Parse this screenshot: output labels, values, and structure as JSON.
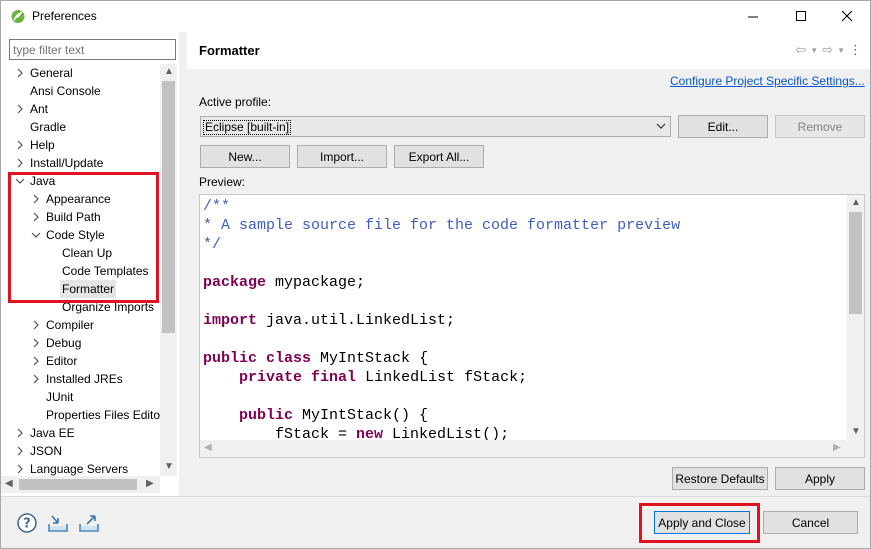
{
  "window": {
    "title": "Preferences",
    "controls": [
      "minimize-icon",
      "maximize-icon",
      "close-icon"
    ]
  },
  "filter": {
    "placeholder": "type filter text"
  },
  "tree": {
    "items": [
      {
        "label": "General",
        "expandable": true,
        "expanded": false
      },
      {
        "label": "Ansi Console",
        "expandable": false
      },
      {
        "label": "Ant",
        "expandable": true,
        "expanded": false
      },
      {
        "label": "Gradle",
        "expandable": false
      },
      {
        "label": "Help",
        "expandable": true,
        "expanded": false
      },
      {
        "label": "Install/Update",
        "expandable": true,
        "expanded": false
      },
      {
        "label": "Java",
        "expandable": true,
        "expanded": true
      },
      {
        "label": "Appearance",
        "expandable": true,
        "expanded": false
      },
      {
        "label": "Build Path",
        "expandable": true,
        "expanded": false
      },
      {
        "label": "Code Style",
        "expandable": true,
        "expanded": true
      },
      {
        "label": "Clean Up",
        "expandable": false
      },
      {
        "label": "Code Templates",
        "expandable": false
      },
      {
        "label": "Formatter",
        "expandable": false,
        "selected": true
      },
      {
        "label": "Organize Imports",
        "expandable": false
      },
      {
        "label": "Compiler",
        "expandable": true,
        "expanded": false
      },
      {
        "label": "Debug",
        "expandable": true,
        "expanded": false
      },
      {
        "label": "Editor",
        "expandable": true,
        "expanded": false
      },
      {
        "label": "Installed JREs",
        "expandable": true,
        "expanded": false
      },
      {
        "label": "JUnit",
        "expandable": false
      },
      {
        "label": "Properties Files Editor",
        "expandable": false
      },
      {
        "label": "Java EE",
        "expandable": true,
        "expanded": false
      },
      {
        "label": "JSON",
        "expandable": true,
        "expanded": false
      },
      {
        "label": "Language Servers",
        "expandable": true,
        "expanded": false
      }
    ]
  },
  "page": {
    "title": "Formatter",
    "nav_back": "⇦",
    "nav_forward": "⇨",
    "nav_menu": "⋮",
    "configure_link": "Configure Project Specific Settings...",
    "active_profile_label": "Active profile:",
    "profile_value": "Eclipse [built-in]",
    "edit_button": "Edit...",
    "remove_button": "Remove",
    "new_button": "New...",
    "import_button": "Import...",
    "export_button": "Export All...",
    "preview_label": "Preview:",
    "restore_defaults_button": "Restore Defaults",
    "apply_button": "Apply"
  },
  "preview_code": [
    {
      "parts": [
        {
          "t": "/**",
          "c": "cm"
        }
      ]
    },
    {
      "parts": [
        {
          "t": "* A sample source file for the code formatter preview",
          "c": "cm"
        }
      ]
    },
    {
      "parts": [
        {
          "t": "*/",
          "c": "cm"
        }
      ]
    },
    {
      "parts": []
    },
    {
      "parts": [
        {
          "t": "package",
          "c": "kw"
        },
        {
          "t": " mypackage;",
          "c": ""
        }
      ]
    },
    {
      "parts": []
    },
    {
      "parts": [
        {
          "t": "import",
          "c": "kw"
        },
        {
          "t": " java.util.LinkedList;",
          "c": ""
        }
      ]
    },
    {
      "parts": []
    },
    {
      "parts": [
        {
          "t": "public",
          "c": "kw"
        },
        {
          "t": " ",
          "c": ""
        },
        {
          "t": "class",
          "c": "kw"
        },
        {
          "t": " MyIntStack {",
          "c": ""
        }
      ]
    },
    {
      "parts": [
        {
          "t": "    ",
          "c": ""
        },
        {
          "t": "private",
          "c": "kw"
        },
        {
          "t": " ",
          "c": ""
        },
        {
          "t": "final",
          "c": "kw"
        },
        {
          "t": " LinkedList fStack;",
          "c": ""
        }
      ]
    },
    {
      "parts": []
    },
    {
      "parts": [
        {
          "t": "    ",
          "c": ""
        },
        {
          "t": "public",
          "c": "kw"
        },
        {
          "t": " MyIntStack() {",
          "c": ""
        }
      ]
    },
    {
      "parts": [
        {
          "t": "        fStack = ",
          "c": ""
        },
        {
          "t": "new",
          "c": "kw"
        },
        {
          "t": " LinkedList();",
          "c": ""
        }
      ]
    }
  ],
  "bottom": {
    "help_icon": "help-icon",
    "import_icon": "import-prefs-icon",
    "export_icon": "export-prefs-icon",
    "apply_close_button": "Apply and Close",
    "cancel_button": "Cancel"
  },
  "colors": {
    "highlight_box": "#e0131e",
    "link": "#0a58c8",
    "keyword": "#7f0055",
    "comment": "#3f5fbf"
  }
}
